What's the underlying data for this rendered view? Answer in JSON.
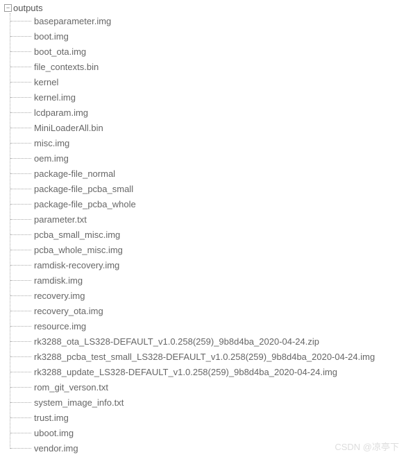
{
  "tree": {
    "root_label": "outputs",
    "items": [
      "baseparameter.img",
      "boot.img",
      "boot_ota.img",
      "file_contexts.bin",
      "kernel",
      "kernel.img",
      "lcdparam.img",
      "MiniLoaderAll.bin",
      "misc.img",
      "oem.img",
      "package-file_normal",
      "package-file_pcba_small",
      "package-file_pcba_whole",
      "parameter.txt",
      "pcba_small_misc.img",
      "pcba_whole_misc.img",
      "ramdisk-recovery.img",
      "ramdisk.img",
      "recovery.img",
      "recovery_ota.img",
      "resource.img",
      "rk3288_ota_LS328-DEFAULT_v1.0.258(259)_9b8d4ba_2020-04-24.zip",
      "rk3288_pcba_test_small_LS328-DEFAULT_v1.0.258(259)_9b8d4ba_2020-04-24.img",
      "rk3288_update_LS328-DEFAULT_v1.0.258(259)_9b8d4ba_2020-04-24.img",
      "rom_git_verson.txt",
      "system_image_info.txt",
      "trust.img",
      "uboot.img",
      "vendor.img"
    ]
  },
  "toggle_glyph": "−",
  "watermark": "CSDN @凉亭下"
}
